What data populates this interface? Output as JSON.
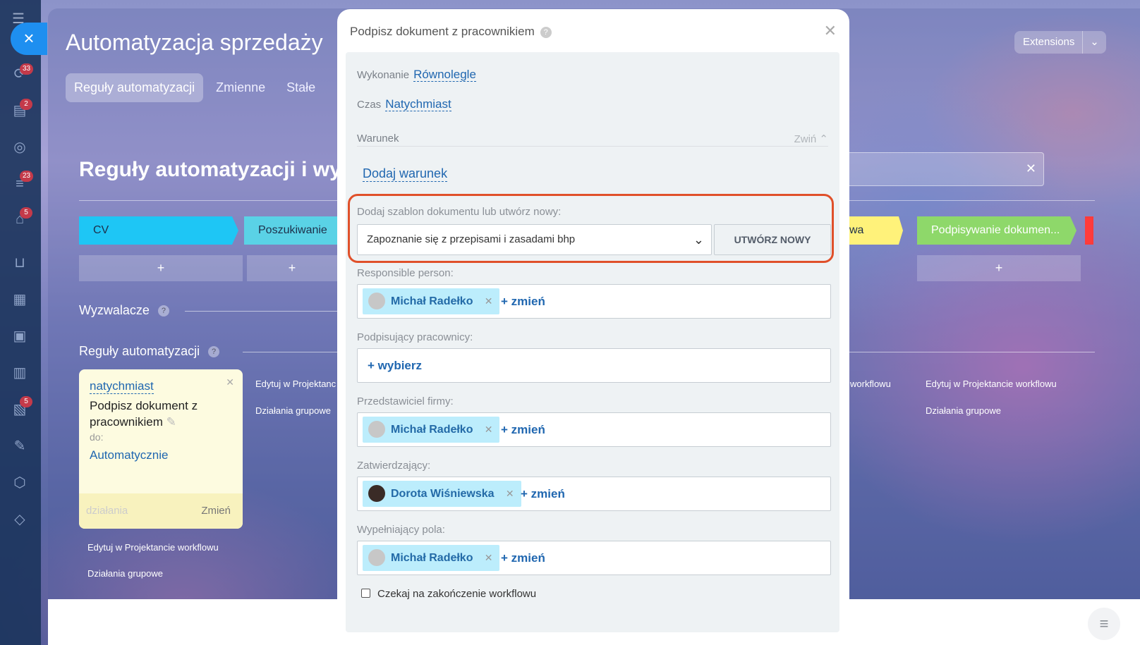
{
  "leftbar": {
    "badges": [
      "33",
      "2",
      "23",
      "5",
      "5"
    ]
  },
  "page": {
    "title": "Automatyzacja sprzedaży",
    "tabs": [
      "Reguły automatyzacji",
      "Zmienne",
      "Stałe"
    ],
    "extensions": "Extensions"
  },
  "board": {
    "title": "Reguły automatyzacji i wy",
    "stages": [
      "CV",
      "Poszukiwanie",
      "wa",
      "Podpisywanie dokumen..."
    ],
    "add": "+",
    "triggers_label": "Wyzwalacze",
    "rules_label": "Reguły automatyzacji",
    "card": {
      "timing": "natychmiast",
      "name": "Podpisz dokument z pracownikiem",
      "to_label": "do:",
      "to_value": "Automatycznie",
      "actions": "działania",
      "change": "Zmień"
    },
    "links": {
      "edit": "Edytuj w Projektancie workflowu",
      "group": "Działania grupowe",
      "edit_short": "Edytuj w Projektanc",
      "workflow_tail": "workflowu"
    }
  },
  "modal": {
    "title": "Podpisz dokument z pracownikiem",
    "execution_label": "Wykonanie",
    "execution_value": "Równolegle",
    "time_label": "Czas",
    "time_value": "Natychmiast",
    "condition_label": "Warunek",
    "collapse": "Zwiń",
    "add_condition": "Dodaj warunek",
    "template_label": "Dodaj szablon dokumentu lub utwórz nowy:",
    "template_value": "Zapoznanie się z przepisami i zasadami bhp",
    "create_new": "UTWÓRZ NOWY",
    "responsible_label": "Responsible person:",
    "responsible": "Michał Radełko",
    "change": "+ zmień",
    "signers_label": "Podpisujący pracownicy:",
    "choose": "+ wybierz",
    "rep_label": "Przedstawiciel firmy:",
    "rep": "Michał Radełko",
    "approver_label": "Zatwierdzający:",
    "approver": "Dorota Wiśniewska",
    "filler_label": "Wypełniający pola:",
    "filler": "Michał Radełko",
    "wait_label": "Czekaj na zakończenie workflowu"
  }
}
